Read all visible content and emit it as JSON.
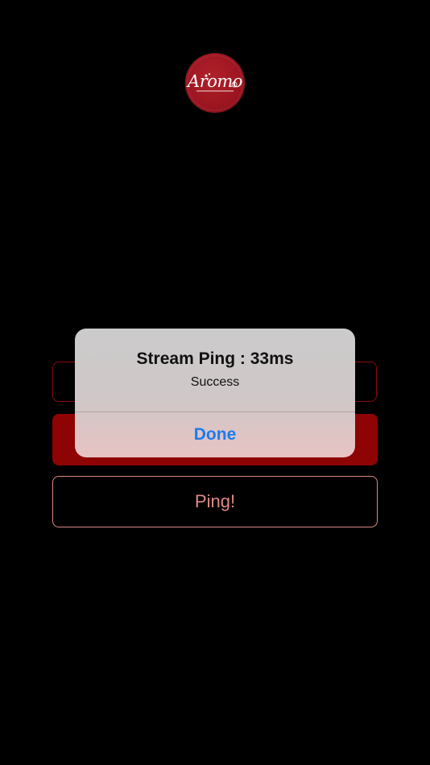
{
  "app": {
    "logo_text": "Aromo",
    "brand_color": "#9c1520"
  },
  "form": {
    "input_value": "",
    "primary_button_label": "",
    "ping_button_label": "Ping!"
  },
  "alert": {
    "title": "Stream Ping : 33ms",
    "message": "Success",
    "action_label": "Done",
    "action_color": "#1a7cf0"
  }
}
